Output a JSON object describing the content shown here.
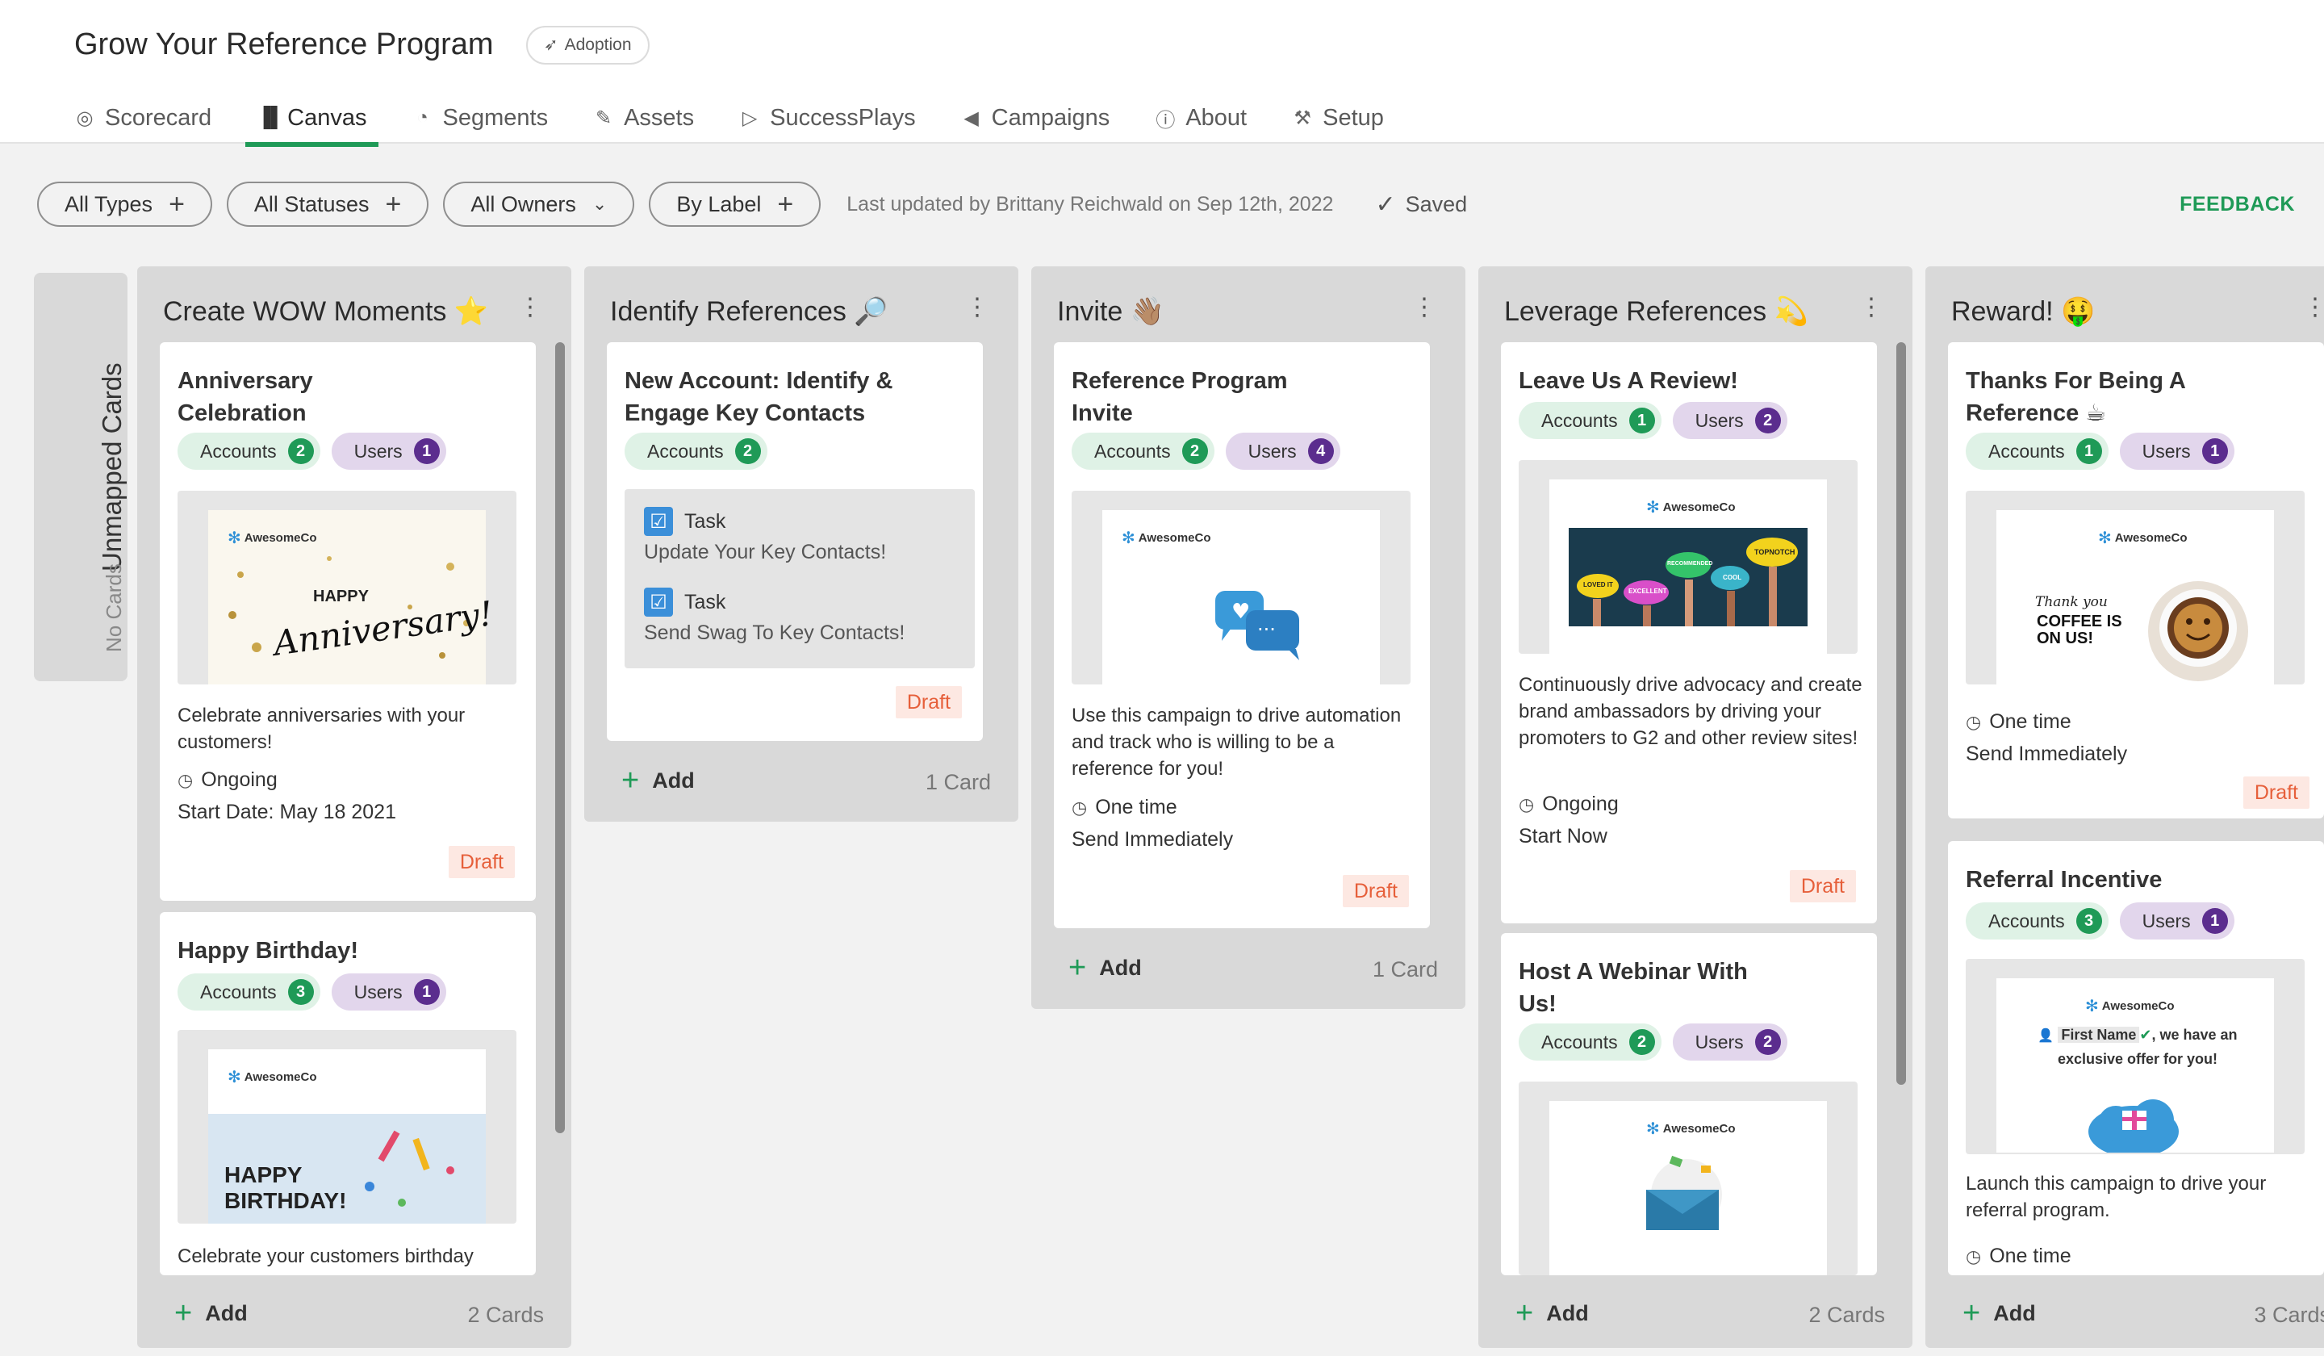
{
  "header": {
    "title": "Grow Your Reference Program",
    "badge": "Adoption",
    "tabs": [
      {
        "label": "Scorecard",
        "icon": "target-icon"
      },
      {
        "label": "Canvas",
        "icon": "board-icon"
      },
      {
        "label": "Segments",
        "icon": "pie-icon"
      },
      {
        "label": "Assets",
        "icon": "paperclip-icon"
      },
      {
        "label": "SuccessPlays",
        "icon": "play-icon"
      },
      {
        "label": "Campaigns",
        "icon": "megaphone-icon"
      },
      {
        "label": "About",
        "icon": "info-icon"
      },
      {
        "label": "Setup",
        "icon": "wrench-icon"
      }
    ],
    "active_tab": "Canvas"
  },
  "toolbar": {
    "filters": [
      "All Types",
      "All Statuses",
      "All Owners",
      "By Label"
    ],
    "updated": "Last updated by Brittany Reichwald on Sep 12th, 2022",
    "saved": "Saved",
    "feedback": "FEEDBACK"
  },
  "unmapped": {
    "title": "Unmapped Cards",
    "sub": "No Cards"
  },
  "columns": [
    {
      "title": "Create WOW Moments ⭐",
      "add": "Add",
      "count": "2 Cards",
      "cards": [
        {
          "title": "Anniversary Celebration",
          "accounts_label": "Accounts",
          "accounts": "2",
          "users_label": "Users",
          "users": "1",
          "thumb_brand": "AwesomeCo",
          "thumb_text_1": "HAPPY",
          "thumb_text_2": "Anniversary!",
          "desc": "Celebrate anniversaries with your customers!",
          "schedule": "Ongoing",
          "detail": "Start Date: May 18 2021",
          "status": "Draft"
        },
        {
          "title": "Happy Birthday!",
          "accounts_label": "Accounts",
          "accounts": "3",
          "users_label": "Users",
          "users": "1",
          "thumb_brand": "AwesomeCo",
          "thumb_text_1": "HAPPY BIRTHDAY!",
          "desc": "Celebrate your customers birthday"
        }
      ]
    },
    {
      "title": "Identify References 🔎",
      "add": "Add",
      "count": "1 Card",
      "cards": [
        {
          "title": "New Account: Identify & Engage Key Contacts",
          "accounts_label": "Accounts",
          "accounts": "2",
          "tasks": [
            {
              "label": "Task",
              "text": "Update Your Key Contacts!"
            },
            {
              "label": "Task",
              "text": "Send Swag To Key Contacts!"
            }
          ],
          "status": "Draft"
        }
      ]
    },
    {
      "title": "Invite 👋🏽",
      "add": "Add",
      "count": "1 Card",
      "cards": [
        {
          "title": "Reference Program Invite",
          "accounts_label": "Accounts",
          "accounts": "2",
          "users_label": "Users",
          "users": "4",
          "thumb_brand": "AwesomeCo",
          "desc": "Use this campaign to drive automation and track who is willing to be a reference for you!",
          "schedule": "One time",
          "detail": "Send Immediately",
          "status": "Draft"
        }
      ]
    },
    {
      "title": "Leverage References 💫",
      "add": "Add",
      "count": "2 Cards",
      "cards": [
        {
          "title": "Leave Us A Review!",
          "accounts_label": "Accounts",
          "accounts": "1",
          "users_label": "Users",
          "users": "2",
          "thumb_brand": "AwesomeCo",
          "thumb_bubbles": [
            "LOVED IT",
            "EXCELLENT",
            "RECOMMENDED",
            "COOL",
            "TOPNOTCH"
          ],
          "desc": "Continuously drive advocacy and create brand ambassadors by driving your promoters to G2 and other review sites!",
          "schedule": "Ongoing",
          "detail": "Start Now",
          "status": "Draft"
        },
        {
          "title": "Host A Webinar With Us!",
          "accounts_label": "Accounts",
          "accounts": "2",
          "users_label": "Users",
          "users": "2",
          "thumb_brand": "AwesomeCo"
        }
      ]
    },
    {
      "title": "Reward! 🤑",
      "add": "Add",
      "count": "3 Cards",
      "cards": [
        {
          "title": "Thanks For Being A Reference ☕",
          "accounts_label": "Accounts",
          "accounts": "1",
          "users_label": "Users",
          "users": "1",
          "thumb_brand": "AwesomeCo",
          "thumb_text_1": "Thank you",
          "thumb_text_2": "COFFEE IS ON US!",
          "schedule": "One time",
          "detail": "Send Immediately",
          "status": "Draft"
        },
        {
          "title": "Referral Incentive",
          "accounts_label": "Accounts",
          "accounts": "3",
          "users_label": "Users",
          "users": "1",
          "thumb_brand": "AwesomeCo",
          "thumb_text_1": "First Name",
          "thumb_text_2": ", we have an exclusive offer for you!",
          "desc": "Launch this campaign to drive your referral program.",
          "schedule": "One time"
        }
      ]
    }
  ],
  "colors": {
    "accent": "#1f9a57",
    "users": "#5b2d8e",
    "draft": "#e65f3a",
    "column_bg": "#d9d9d9"
  }
}
